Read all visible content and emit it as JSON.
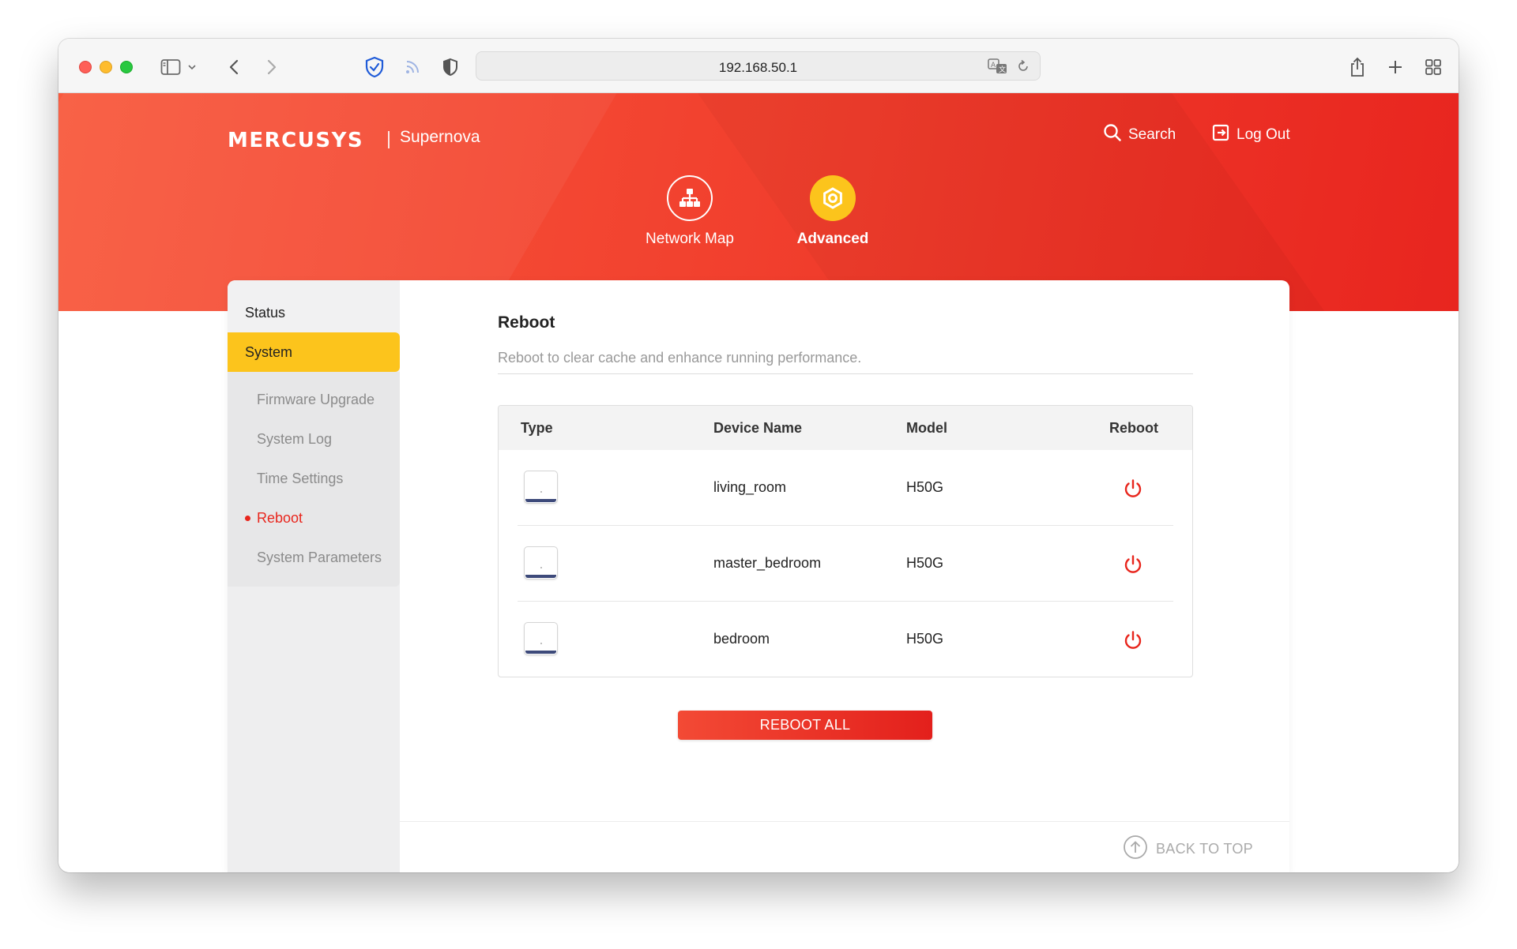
{
  "browser": {
    "url": "192.168.50.1"
  },
  "header": {
    "brand": "MERCUSYS",
    "product": "Supernova",
    "search_label": "Search",
    "logout_label": "Log Out",
    "nav": [
      {
        "label": "Network Map",
        "icon": "network-map-icon"
      },
      {
        "label": "Advanced",
        "icon": "gear-icon",
        "active": true
      }
    ]
  },
  "sidebar": {
    "items": [
      {
        "label": "Status"
      },
      {
        "label": "System",
        "active": true
      }
    ],
    "sub_items": [
      {
        "label": "Firmware Upgrade"
      },
      {
        "label": "System Log"
      },
      {
        "label": "Time Settings"
      },
      {
        "label": "Reboot",
        "current": true
      },
      {
        "label": "System Parameters"
      }
    ]
  },
  "main": {
    "title": "Reboot",
    "description": "Reboot to clear cache and enhance running performance.",
    "table": {
      "headers": [
        "Type",
        "Device Name",
        "Model",
        "Reboot"
      ],
      "rows": [
        {
          "device_name": "living_room",
          "model": "H50G"
        },
        {
          "device_name": "master_bedroom",
          "model": "H50G"
        },
        {
          "device_name": "bedroom",
          "model": "H50G"
        }
      ]
    },
    "reboot_all_label": "REBOOT ALL",
    "back_to_top_label": "BACK TO TOP"
  },
  "colors": {
    "brand_red": "#e8261d",
    "active_yellow": "#fcc41c"
  }
}
